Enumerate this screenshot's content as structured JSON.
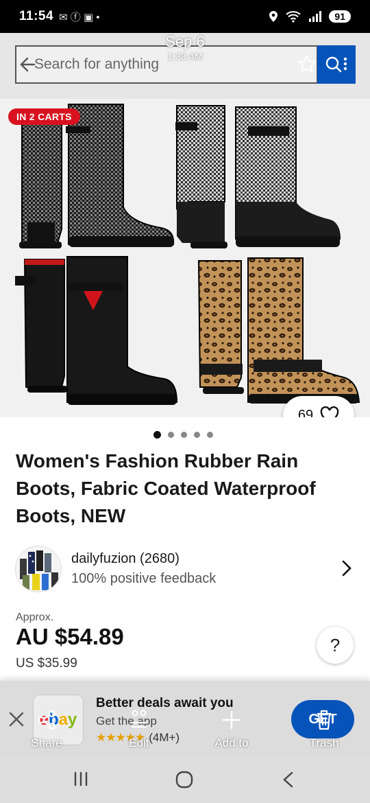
{
  "status_bar": {
    "time": "11:54",
    "battery": "91"
  },
  "search": {
    "placeholder": "Search for anything"
  },
  "screenshot_overlay": {
    "date": "Sep 6",
    "time": "1:33 AM"
  },
  "listing": {
    "carts_badge": "IN 2 CARTS",
    "watch_count": "69",
    "image_count": 5,
    "active_image_index": 0,
    "title": "Women's Fashion Rubber Rain Boots, Fabric Coated Waterproof Boots, NEW",
    "seller": {
      "name": "dailyfuzion (2680)",
      "feedback": "100% positive feedback"
    },
    "price": {
      "approx_label": "Approx.",
      "primary": "AU $54.89",
      "secondary": "US $35.99"
    },
    "help_label": "?"
  },
  "app_banner": {
    "logo_text": "ebay",
    "title": "Better deals await you",
    "subtitle": "Get the app",
    "rating_stars": "★★★★★",
    "rating_count": "(4M+)",
    "button_label": "GET"
  },
  "toolbar": {
    "share": "Share",
    "edit": "Edit",
    "add_to": "Add to",
    "trash": "Trash"
  },
  "colors": {
    "accent": "#0654ba",
    "badge_red": "#d8121f",
    "star": "#e5a000"
  }
}
